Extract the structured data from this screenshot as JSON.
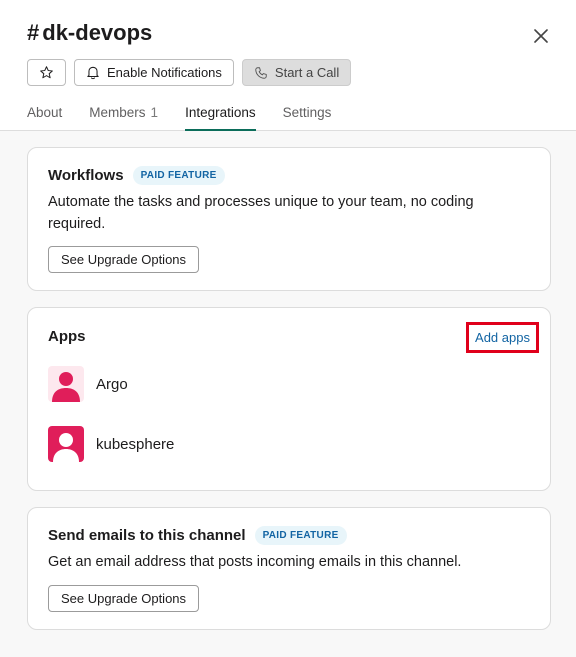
{
  "header": {
    "hash": "#",
    "title": "dk-devops",
    "buttons": {
      "enable_notifications": "Enable Notifications",
      "start_call": "Start a Call"
    },
    "tabs": [
      {
        "label": "About"
      },
      {
        "label": "Members",
        "count": "1"
      },
      {
        "label": "Integrations",
        "active": true
      },
      {
        "label": "Settings"
      }
    ]
  },
  "workflows": {
    "title": "Workflows",
    "badge": "PAID FEATURE",
    "description": "Automate the tasks and processes unique to your team, no coding required.",
    "button": "See Upgrade Options"
  },
  "apps": {
    "title": "Apps",
    "add_label": "Add apps",
    "items": [
      {
        "name": "Argo",
        "icon": "user-avatar-icon"
      },
      {
        "name": "kubesphere",
        "icon": "user-avatar-icon"
      }
    ]
  },
  "emails": {
    "title": "Send emails to this channel",
    "badge": "PAID FEATURE",
    "description": "Get an email address that posts incoming emails in this channel.",
    "button": "See Upgrade Options"
  },
  "colors": {
    "accent_tab": "#0b6d5a",
    "link": "#1264a3",
    "avatar": "#e01e5a",
    "highlight": "#e0001b"
  }
}
